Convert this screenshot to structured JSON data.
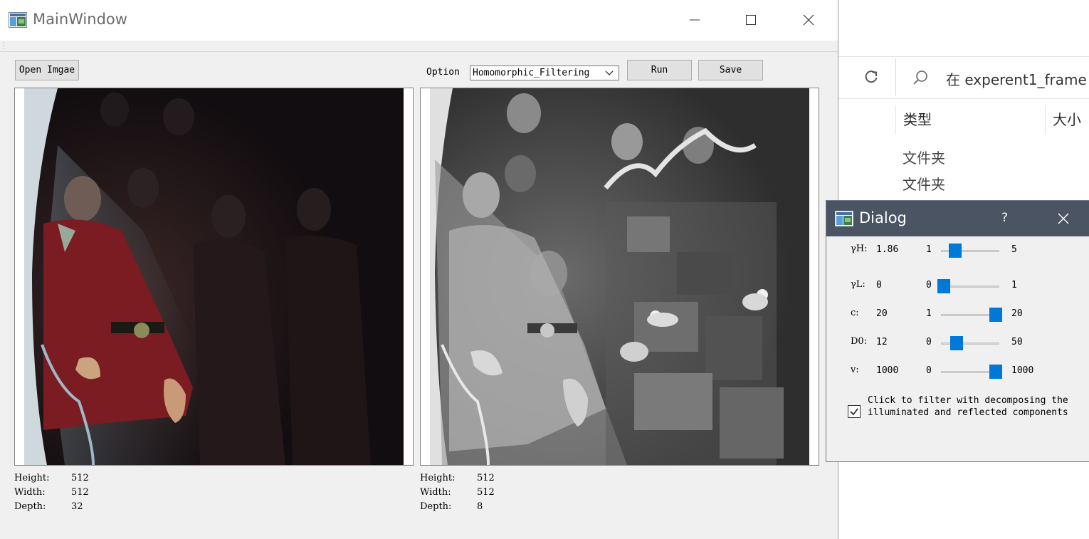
{
  "explorer": {
    "search_placeholder": "在 experent1_frame",
    "columns": {
      "type": "类型",
      "size": "大小"
    },
    "rows": [
      "文件夹",
      "文件夹"
    ]
  },
  "main_window": {
    "title": "MainWindow",
    "open_button": "Open Imgae",
    "option_label": "Option",
    "option_selected": "Homomorphic_Filtering",
    "run_button": "Run",
    "save_button": "Save",
    "left_info": [
      {
        "key": "Height:",
        "value": "512"
      },
      {
        "key": "Width:",
        "value": "512"
      },
      {
        "key": "Depth:",
        "value": "32"
      }
    ],
    "right_info": [
      {
        "key": "Height:",
        "value": "512"
      },
      {
        "key": "Width:",
        "value": "512"
      },
      {
        "key": "Depth:",
        "value": "8"
      }
    ]
  },
  "dialog": {
    "title": "Dialog",
    "help": "?",
    "params": [
      {
        "label": "γH:",
        "value": "1.86",
        "min": "1",
        "max": "5",
        "level": 0.215
      },
      {
        "label": "γL:",
        "value": "0",
        "min": "0",
        "max": "1",
        "level": 0.0
      },
      {
        "label": "c:",
        "value": "20",
        "min": "1",
        "max": "20",
        "level": 1.0
      },
      {
        "label": "D0:",
        "value": "12",
        "min": "0",
        "max": "50",
        "level": 0.24
      },
      {
        "label": "v:",
        "value": "1000",
        "min": "0",
        "max": "1000",
        "level": 1.0
      }
    ],
    "checkbox_checked": true,
    "checkbox_text_line1": "Click to filter with decomposing the",
    "checkbox_text_line2": "illuminated and reflected components"
  },
  "colors": {
    "accent": "#0078d7",
    "dialog_titlebar": "#4a5463"
  }
}
